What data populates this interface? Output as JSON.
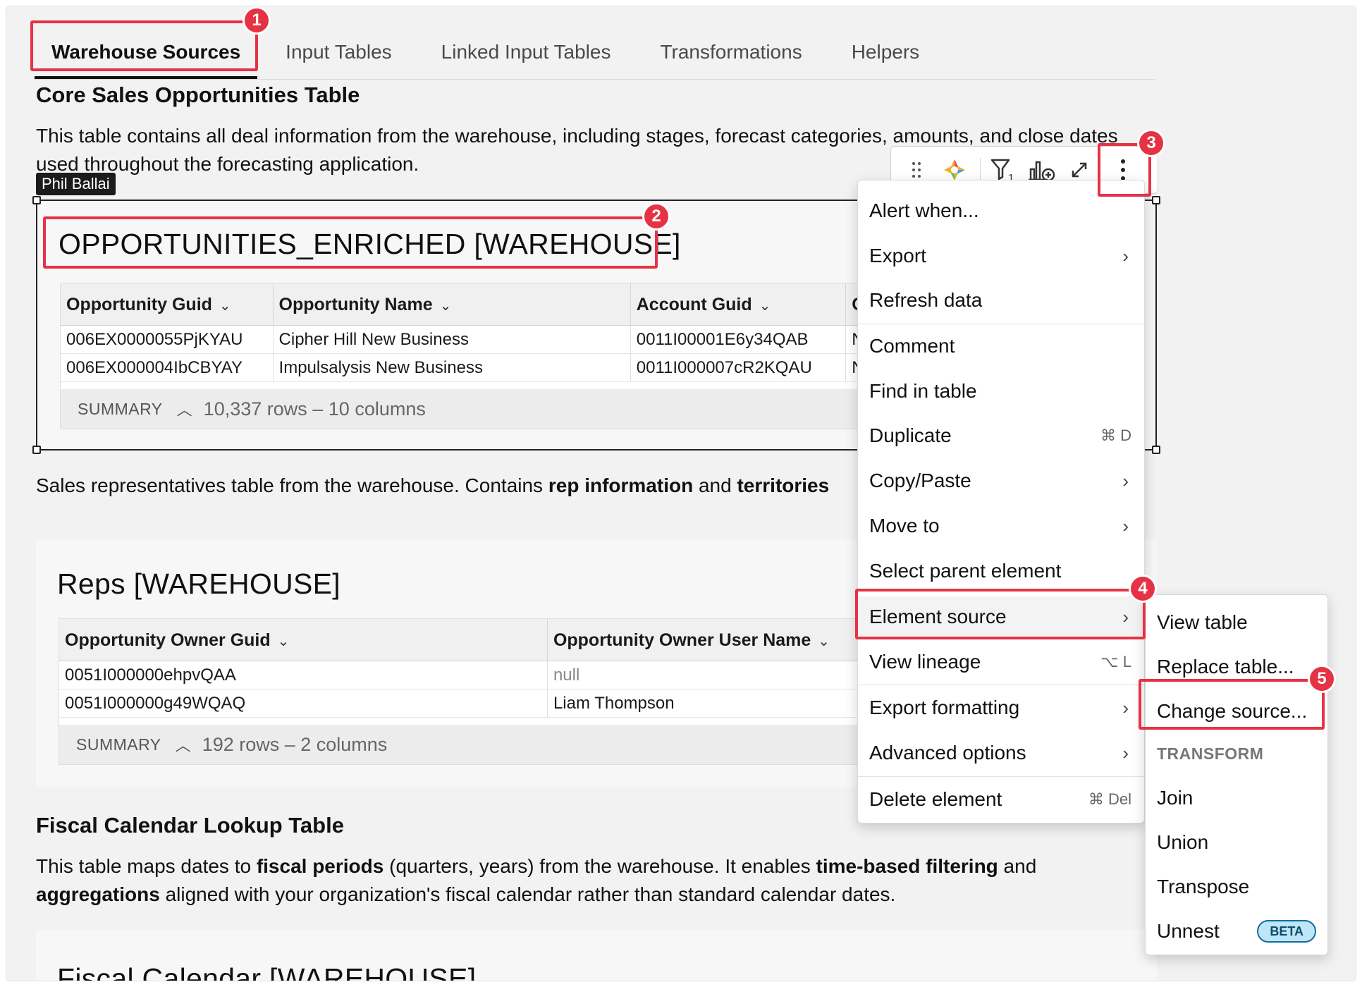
{
  "tabs": [
    "Warehouse Sources",
    "Input Tables",
    "Linked Input Tables",
    "Transformations",
    "Helpers"
  ],
  "section1": {
    "title": "Core Sales Opportunities Table",
    "description": "This table contains all deal information from the warehouse, including stages, forecast categories, amounts, and close dates used throughout the forecasting application."
  },
  "user_badge": "Phil Ballai",
  "table1": {
    "title": "OPPORTUNITIES_ENRICHED [WAREHOUSE]",
    "columns": [
      "Opportunity Guid",
      "Opportunity Name",
      "Account Guid",
      "O"
    ],
    "rows": [
      [
        "006EX0000055PjKYAU",
        "Cipher Hill New Business",
        "0011I00001E6y34QAB",
        "N"
      ],
      [
        "006EX000004IbCBYAY",
        "Impulsalysis New Business",
        "0011I000007cR2KQAU",
        "N"
      ]
    ],
    "summary_label": "SUMMARY",
    "summary_value": "10,337 rows – 10 columns"
  },
  "section2": {
    "text_before": "Sales representatives table from the warehouse. Contains ",
    "bold1": "rep information",
    "text_mid": " and ",
    "bold2": "territories"
  },
  "table2": {
    "title": "Reps [WAREHOUSE]",
    "columns": [
      "Opportunity Owner Guid",
      "Opportunity Owner User Name"
    ],
    "rows": [
      [
        "0051I000000ehpvQAA",
        "null"
      ],
      [
        "0051I000000g49WQAQ",
        "Liam Thompson"
      ]
    ],
    "summary_label": "SUMMARY",
    "summary_value": "192 rows – 2 columns"
  },
  "section3": {
    "title": "Fiscal Calendar Lookup Table",
    "p1": "This table maps dates to ",
    "b1": "fiscal periods",
    "p2": " (quarters, years) from the warehouse. It enables ",
    "b2": "time-based filtering",
    "p3": " and ",
    "b3": "aggregations",
    "p4": " aligned with your organization's fiscal calendar rather than standard calendar dates."
  },
  "table3": {
    "title": "Fiscal Calendar [WAREHOUSE]"
  },
  "toolbar": {
    "filter_sub": "1",
    "icons": [
      "drag-handle-icon",
      "ai-sparkle-icon",
      "filter-icon",
      "add-chart-icon",
      "expand-icon",
      "more-options-icon"
    ]
  },
  "context_menu": {
    "alert_when": "Alert when...",
    "export": "Export",
    "refresh": "Refresh data",
    "comment": "Comment",
    "find": "Find in table",
    "duplicate": "Duplicate",
    "duplicate_kbd": "⌘ D",
    "copy_paste": "Copy/Paste",
    "move_to": "Move to",
    "select_parent": "Select parent element",
    "element_source": "Element source",
    "view_lineage": "View lineage",
    "view_lineage_kbd": "⌥ L",
    "export_formatting": "Export formatting",
    "advanced": "Advanced options",
    "delete": "Delete element",
    "delete_kbd": "⌘ Del"
  },
  "submenu": {
    "view_table": "View table",
    "replace_table": "Replace table...",
    "change_source": "Change source...",
    "transform_header": "TRANSFORM",
    "join": "Join",
    "union": "Union",
    "transpose": "Transpose",
    "unnest": "Unnest",
    "beta": "BETA"
  },
  "callouts": [
    "1",
    "2",
    "3",
    "4",
    "5"
  ],
  "colors": {
    "callout": "#e53345",
    "beta_bg": "#bfe6f7",
    "beta_border": "#0f6e9c"
  }
}
